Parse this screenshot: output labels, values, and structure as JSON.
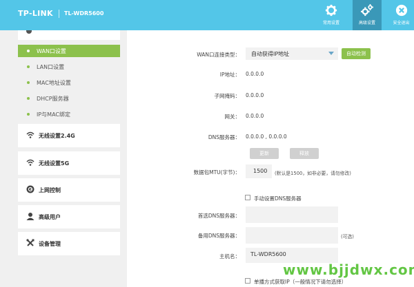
{
  "header": {
    "brand": "TP-LINK",
    "model": "TL-WDR5600",
    "nav": [
      {
        "label": "常用设置",
        "icon": "gear-icon",
        "active": false
      },
      {
        "label": "高级设置",
        "icon": "gears-icon",
        "active": true
      },
      {
        "label": "安全退出",
        "icon": "close-icon",
        "active": false
      }
    ]
  },
  "sidebar": {
    "sub_items": [
      {
        "label": "WAN口设置",
        "active": true
      },
      {
        "label": "LAN口设置",
        "active": false
      },
      {
        "label": "MAC地址设置",
        "active": false
      },
      {
        "label": "DHCP服务器",
        "active": false
      },
      {
        "label": "IP与MAC绑定",
        "active": false
      }
    ],
    "menu_items": [
      {
        "label": "无线设置2.4G",
        "icon": "wifi-icon"
      },
      {
        "label": "无线设置5G",
        "icon": "wifi-icon"
      },
      {
        "label": "上网控制",
        "icon": "globe-icon"
      },
      {
        "label": "高级用户",
        "icon": "user-icon"
      },
      {
        "label": "设备管理",
        "icon": "tools-icon"
      }
    ]
  },
  "form": {
    "wan_type_label": "WAN口连接类型：",
    "wan_type_value": "自动获得IP地址",
    "detect_button": "自动检测",
    "ip_label": "IP地址：",
    "ip_value": "0.0.0.0",
    "mask_label": "子网掩码：",
    "mask_value": "0.0.0.0",
    "gateway_label": "网关：",
    "gateway_value": "0.0.0.0",
    "dns_label": "DNS服务器：",
    "dns_value": "0.0.0.0 , 0.0.0.0",
    "renew_button": "更新",
    "release_button": "释放",
    "mtu_label": "数据包MTU(字节)：",
    "mtu_value": "1500",
    "mtu_hint": "(默认是1500，如非必要，请勿修改)",
    "manual_dns_label": "手动设置DNS服务器",
    "primary_dns_label": "首选DNS服务器：",
    "primary_dns_value": "",
    "secondary_dns_label": "备用DNS服务器：",
    "secondary_dns_value": "",
    "optional_hint": "(可选)",
    "hostname_label": "主机名：",
    "hostname_value": "TL-WDR5600",
    "unicast_label": "单播方式获取IP（一般情况下请勿选择）"
  },
  "watermark": "www.bjjdwx.com"
}
